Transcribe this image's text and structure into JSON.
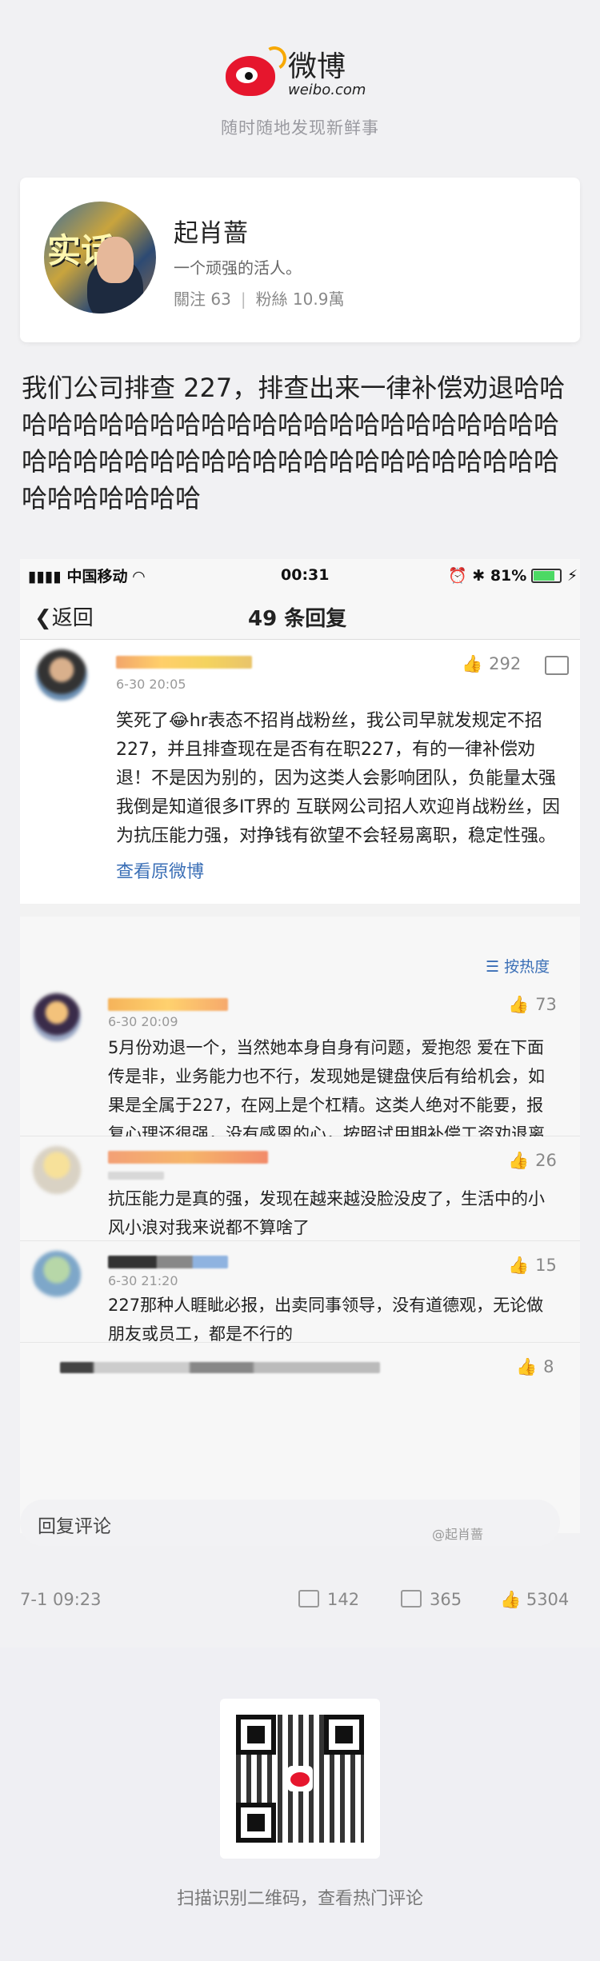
{
  "brand": {
    "logo_cn": "微博",
    "logo_en": "weibo.com",
    "slogan": "随时随地发现新鲜事",
    "color": "#e6162d"
  },
  "profile": {
    "name": "起肖蔷",
    "bio": "一个顽强的活人。",
    "following": "關注 63",
    "followers": "粉絲 10.9萬"
  },
  "post": {
    "text": "我们公司排查 227，排查出来一律补偿劝退哈哈哈哈哈哈哈哈哈哈哈哈哈哈哈哈哈哈哈哈哈哈哈哈哈哈哈哈哈哈哈哈哈哈哈哈哈哈哈哈哈哈哈哈哈哈哈哈哈哈哈"
  },
  "screenshot": {
    "status": {
      "carrier": "中国移动",
      "time": "00:31",
      "battery": "81%"
    },
    "nav": {
      "back": "返回",
      "title": "49 条回复"
    },
    "main_comment": {
      "time": "6-30 20:05",
      "likes": "292",
      "text": "笑死了😂hr表态不招肖战粉丝，我公司早就发规定不招227，并且排查现在是否有在职227，有的一律补偿劝退！不是因为别的，因为这类人会影响团队，负能量太强 我倒是知道很多IT界的 互联网公司招人欢迎肖战粉丝，因为抗压能力强，对挣钱有欲望不会轻易离职，稳定性强。",
      "link": "查看原微博"
    },
    "sort_label": "按热度",
    "replies": [
      {
        "time": "6-30 20:09",
        "likes": "73",
        "text": "5月份劝退一个，当然她本身自身有问题，爱抱怨 爱在下面传是非，业务能力也不行，发现她是键盘侠后有给机会，如果是全属于227，在网上是个杠精。这类人绝对不能要，报复心理还很强，没有感恩的心，按照试用期补偿工资劝退离职。"
      },
      {
        "time": "",
        "likes": "26",
        "text": "抗压能力是真的强，发现在越来越没脸没皮了，生活中的小风小浪对我来说都不算啥了"
      },
      {
        "time": "6-30 21:20",
        "likes": "15",
        "text": "227那种人睚眦必报，出卖同事领导，没有道德观，无论做朋友或员工，都是不行的"
      },
      {
        "time": "",
        "likes": "8",
        "text": ""
      }
    ]
  },
  "reply_placeholder": "回复评论",
  "watermark": "@起肖蔷",
  "footer": {
    "date": "7-1 09:23",
    "reposts": "142",
    "comments": "365",
    "likes": "5304"
  },
  "qr_caption": "扫描识别二维码，查看热门评论"
}
